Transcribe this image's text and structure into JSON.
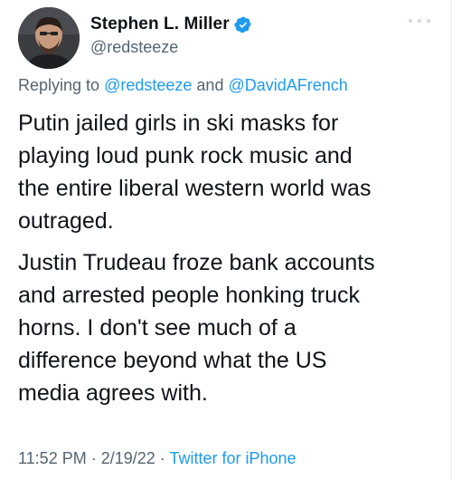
{
  "author": {
    "display_name": "Stephen L. Miller",
    "handle": "@redsteeze",
    "verified": true,
    "verified_color": "#1d9bf0"
  },
  "reply": {
    "prefix": "Replying to",
    "mention_1": "@redsteeze",
    "conjunction": "and",
    "mention_2": "@DavidAFrench"
  },
  "tweet": {
    "paragraph_1": "Putin jailed girls in ski masks for\nplaying loud punk rock music and\nthe entire liberal western world was\noutraged.",
    "paragraph_2": "Justin Trudeau froze bank accounts\nand arrested people honking truck\nhorns. I don't see much of a\ndifference beyond what the US\nmedia agrees with."
  },
  "meta": {
    "time": "11:52 PM",
    "separator_1": " · ",
    "date": "2/19/22",
    "separator_2": " · ",
    "source": "Twitter for iPhone"
  },
  "colors": {
    "text": "#0f1419",
    "secondary": "#536471",
    "link": "#1d9bf0"
  },
  "icons": {
    "verified": "verified-badge-icon",
    "more": "more-options-icon"
  }
}
